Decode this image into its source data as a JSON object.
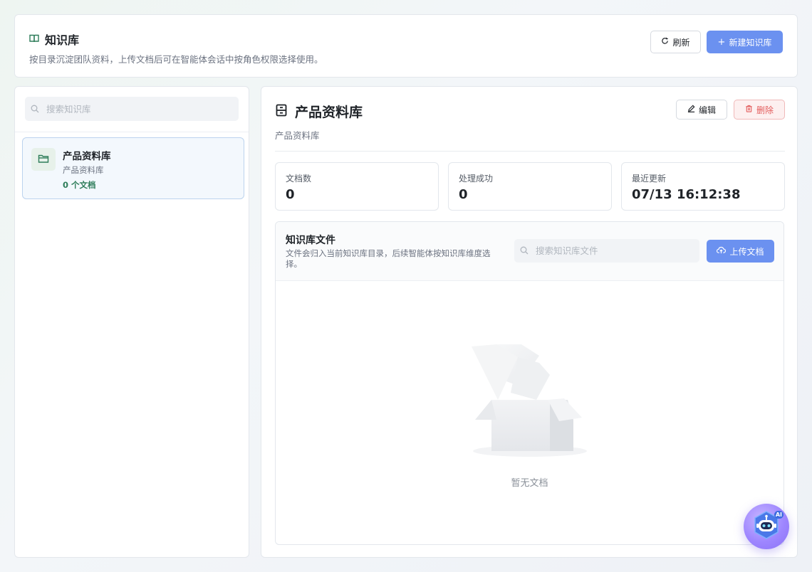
{
  "header": {
    "title": "知识库",
    "description": "按目录沉淀团队资料，上传文档后可在智能体会话中按角色权限选择使用。",
    "refresh_label": "刷新",
    "new_kb_label": "新建知识库"
  },
  "sidebar": {
    "search_placeholder": "搜索知识库",
    "items": [
      {
        "name": "产品资料库",
        "description": "产品资料库",
        "doc_count": "0 个文档"
      }
    ]
  },
  "detail": {
    "title": "产品资料库",
    "description": "产品资料库",
    "edit_label": "编辑",
    "delete_label": "删除",
    "stats": [
      {
        "label": "文档数",
        "value": "0"
      },
      {
        "label": "处理成功",
        "value": "0"
      },
      {
        "label": "最近更新",
        "value": "07/13 16:12:38"
      }
    ],
    "files": {
      "title": "知识库文件",
      "description": "文件会归入当前知识库目录，后续智能体按知识库维度选择。",
      "search_placeholder": "搜索知识库文件",
      "upload_label": "上传文档",
      "empty_text": "暂无文档"
    }
  },
  "fab": {
    "badge": "AI"
  },
  "colors": {
    "primary": "#6b91f0",
    "danger": "#e35d5d",
    "success_text": "#2e7d5a",
    "selected_bg": "#f3f8fd",
    "selected_border": "#bcd3ee"
  },
  "icons": {
    "header": "book-open-icon",
    "refresh": "refresh-icon",
    "new": "plus-icon",
    "search": "search-icon",
    "kb_item": "folder-icon",
    "detail": "archive-icon",
    "edit": "pencil-icon",
    "delete": "trash-icon",
    "upload": "cloud-upload-icon",
    "empty": "empty-box-illustration",
    "fab": "robot-icon"
  }
}
